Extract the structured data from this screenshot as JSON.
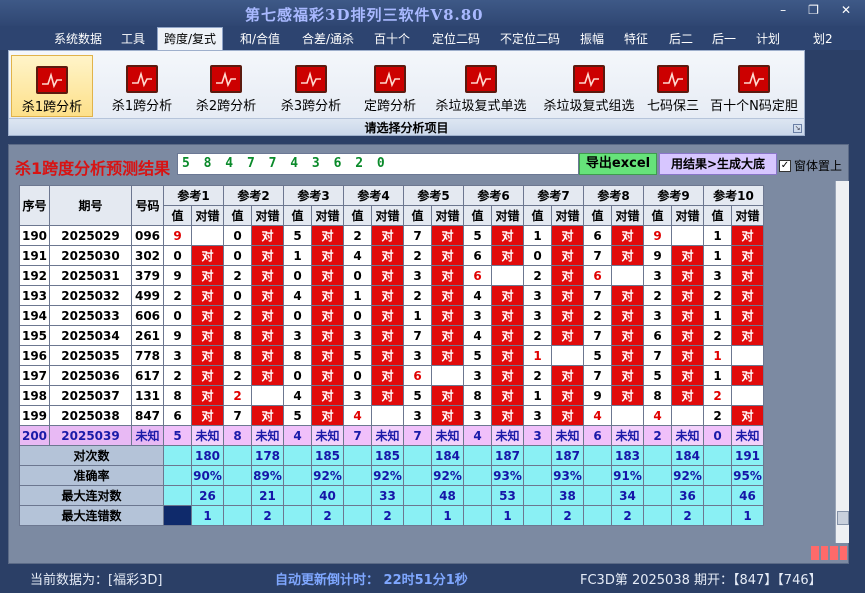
{
  "window": {
    "title": "第七感福彩3D排列三软件V8.80",
    "min_glyph": "–",
    "max_glyph": "❐",
    "close_glyph": "✕"
  },
  "menu": [
    "系统数据",
    "工具",
    "跨度/复式",
    "和/合值",
    "合差/通杀",
    "百十个",
    "定位二码",
    "不定位二码",
    "振幅",
    "特征",
    "后二",
    "后一",
    "计划",
    "划2"
  ],
  "menu_active_index": 2,
  "ribbon": {
    "buttons": [
      "杀1跨分析",
      "杀1跨分析",
      "杀2跨分析",
      "杀3跨分析",
      "定跨分析",
      "杀垃圾复式单选",
      "杀垃圾复式组选",
      "七码保三",
      "百十个N码定胆"
    ],
    "active_index": 0,
    "caption": "请选择分析项目"
  },
  "result": {
    "title": "杀1跨度分析预测结果",
    "numbers": "5 8 4 7 7 4 3 6 2 0",
    "export_button": "导出excel",
    "generate_button": "用结果>生成大底",
    "topmost_label": "窗体置上",
    "topmost_checked": true,
    "check_glyph": "✓"
  },
  "table": {
    "headers": {
      "seq": "序号",
      "period": "期号",
      "number": "号码",
      "value": "值",
      "verdict": "对错"
    },
    "refs": [
      "参考1",
      "参考2",
      "参考3",
      "参考4",
      "参考5",
      "参考6",
      "参考7",
      "参考8",
      "参考9",
      "参考10"
    ],
    "ok_text": "对",
    "rows": [
      {
        "seq": "190",
        "period": "2025029",
        "num": "096",
        "v": [
          "9",
          "0",
          "5",
          "2",
          "7",
          "5",
          "1",
          "6",
          "9",
          "1"
        ],
        "ok": [
          false,
          true,
          true,
          true,
          true,
          true,
          true,
          true,
          false,
          true
        ],
        "red": [
          true,
          false,
          false,
          false,
          false,
          false,
          false,
          false,
          true,
          false
        ]
      },
      {
        "seq": "191",
        "period": "2025030",
        "num": "302",
        "v": [
          "0",
          "0",
          "1",
          "4",
          "2",
          "6",
          "0",
          "7",
          "9",
          "1"
        ],
        "ok": [
          true,
          true,
          true,
          true,
          true,
          true,
          true,
          true,
          true,
          true
        ],
        "red": [
          false,
          false,
          false,
          false,
          false,
          false,
          false,
          false,
          false,
          false
        ]
      },
      {
        "seq": "192",
        "period": "2025031",
        "num": "379",
        "v": [
          "9",
          "2",
          "0",
          "0",
          "3",
          "6",
          "2",
          "6",
          "3",
          "3"
        ],
        "ok": [
          true,
          true,
          true,
          true,
          true,
          false,
          true,
          false,
          true,
          true
        ],
        "red": [
          false,
          false,
          false,
          false,
          false,
          true,
          false,
          true,
          false,
          false
        ]
      },
      {
        "seq": "193",
        "period": "2025032",
        "num": "499",
        "v": [
          "2",
          "0",
          "4",
          "1",
          "2",
          "4",
          "3",
          "7",
          "2",
          "2"
        ],
        "ok": [
          true,
          true,
          true,
          true,
          true,
          true,
          true,
          true,
          true,
          true
        ],
        "red": [
          false,
          false,
          false,
          false,
          false,
          false,
          false,
          false,
          false,
          false
        ]
      },
      {
        "seq": "194",
        "period": "2025033",
        "num": "606",
        "v": [
          "0",
          "2",
          "0",
          "0",
          "1",
          "3",
          "3",
          "2",
          "3",
          "1"
        ],
        "ok": [
          true,
          true,
          true,
          true,
          true,
          true,
          true,
          true,
          true,
          true
        ],
        "red": [
          false,
          false,
          false,
          false,
          false,
          false,
          false,
          false,
          false,
          false
        ]
      },
      {
        "seq": "195",
        "period": "2025034",
        "num": "261",
        "v": [
          "9",
          "8",
          "3",
          "3",
          "7",
          "4",
          "2",
          "7",
          "6",
          "2"
        ],
        "ok": [
          true,
          true,
          true,
          true,
          true,
          true,
          true,
          true,
          true,
          true
        ],
        "red": [
          false,
          false,
          false,
          false,
          false,
          false,
          false,
          false,
          false,
          false
        ]
      },
      {
        "seq": "196",
        "period": "2025035",
        "num": "778",
        "v": [
          "3",
          "8",
          "8",
          "5",
          "3",
          "5",
          "1",
          "5",
          "7",
          "1"
        ],
        "ok": [
          true,
          true,
          true,
          true,
          true,
          true,
          false,
          true,
          true,
          false
        ],
        "red": [
          false,
          false,
          false,
          false,
          false,
          false,
          true,
          false,
          false,
          true
        ]
      },
      {
        "seq": "197",
        "period": "2025036",
        "num": "617",
        "v": [
          "2",
          "2",
          "0",
          "0",
          "6",
          "3",
          "2",
          "7",
          "5",
          "1"
        ],
        "ok": [
          true,
          true,
          true,
          true,
          false,
          true,
          true,
          true,
          true,
          true
        ],
        "red": [
          false,
          false,
          false,
          false,
          true,
          false,
          false,
          false,
          false,
          false
        ]
      },
      {
        "seq": "198",
        "period": "2025037",
        "num": "131",
        "v": [
          "8",
          "2",
          "4",
          "3",
          "5",
          "8",
          "1",
          "9",
          "8",
          "2"
        ],
        "ok": [
          true,
          false,
          true,
          true,
          true,
          true,
          true,
          true,
          true,
          false
        ],
        "red": [
          false,
          true,
          false,
          false,
          false,
          false,
          false,
          false,
          false,
          true
        ]
      },
      {
        "seq": "199",
        "period": "2025038",
        "num": "847",
        "v": [
          "6",
          "7",
          "5",
          "4",
          "3",
          "3",
          "3",
          "4",
          "4",
          "2"
        ],
        "ok": [
          true,
          true,
          true,
          false,
          true,
          true,
          true,
          false,
          false,
          true
        ],
        "red": [
          false,
          false,
          false,
          true,
          false,
          false,
          false,
          true,
          true,
          false
        ]
      }
    ],
    "predict": {
      "seq": "200",
      "period": "2025039",
      "num": "未知",
      "v": [
        "5",
        "8",
        "4",
        "7",
        "7",
        "4",
        "3",
        "6",
        "2",
        "0"
      ],
      "unknown": "未知"
    },
    "stats": [
      {
        "label": "对次数",
        "values": [
          "180",
          "178",
          "185",
          "185",
          "184",
          "187",
          "187",
          "183",
          "184",
          "191"
        ]
      },
      {
        "label": "准确率",
        "values": [
          "90%",
          "89%",
          "92%",
          "92%",
          "92%",
          "93%",
          "93%",
          "91%",
          "92%",
          "95%"
        ]
      },
      {
        "label": "最大连对数",
        "values": [
          "26",
          "21",
          "40",
          "33",
          "48",
          "53",
          "38",
          "34",
          "36",
          "46"
        ]
      },
      {
        "label": "最大连错数",
        "values": [
          "1",
          "2",
          "2",
          "2",
          "1",
          "1",
          "2",
          "2",
          "2",
          "1"
        ]
      }
    ]
  },
  "status": {
    "current_data": "当前数据为：[福彩3D]",
    "countdown": "自动更新倒计时：  22时51分1秒",
    "draw": "FC3D第 2025038 期开：【847】【746】"
  }
}
